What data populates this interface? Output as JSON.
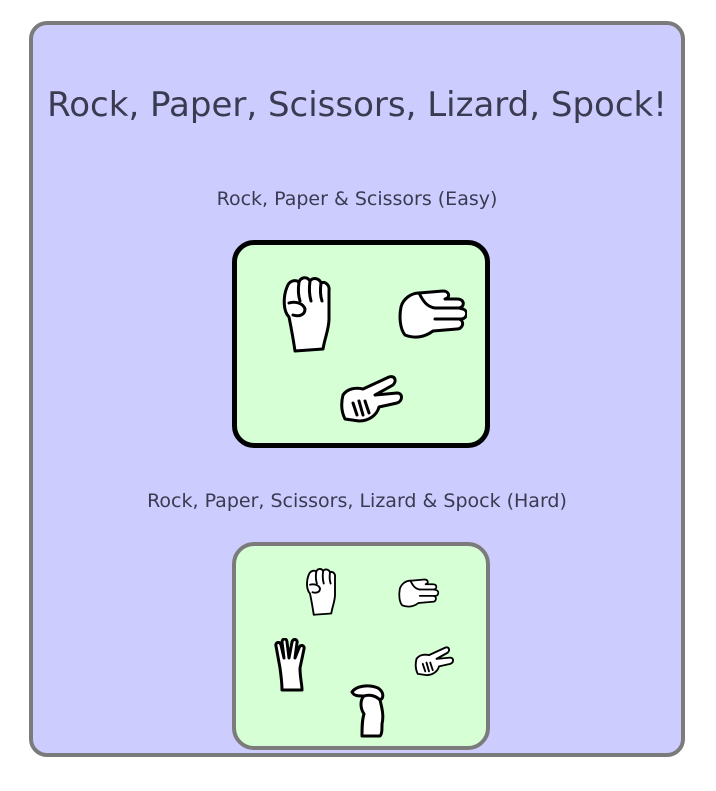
{
  "game": {
    "title": "Rock, Paper, Scissors, Lizard, Spock!",
    "modes": [
      {
        "label": "Rock, Paper & Scissors (Easy)",
        "selected": true,
        "hands": [
          {
            "icon": "rock-hand-icon"
          },
          {
            "icon": "paper-hand-icon"
          },
          {
            "icon": "scissors-hand-icon"
          }
        ]
      },
      {
        "label": "Rock, Paper, Scissors, Lizard & Spock (Hard)",
        "selected": false,
        "hands": [
          {
            "icon": "rock-hand-icon"
          },
          {
            "icon": "paper-hand-icon"
          },
          {
            "icon": "spock-hand-icon"
          },
          {
            "icon": "scissors-hand-icon"
          },
          {
            "icon": "lizard-hand-icon"
          }
        ]
      }
    ]
  },
  "colors": {
    "panel_bg": "#ccccff",
    "panel_border": "#7b7b7b",
    "card_bg": "#d6ffd6",
    "selected_border": "#000000",
    "text": "#3a3a50"
  }
}
